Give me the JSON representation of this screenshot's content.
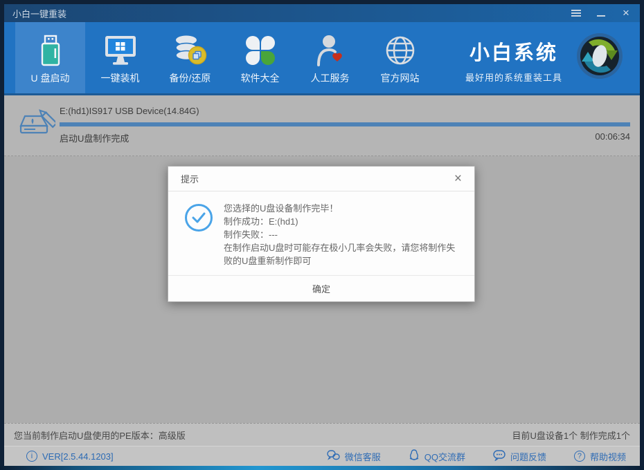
{
  "window": {
    "title": "小白一键重装"
  },
  "nav": {
    "items": [
      {
        "label": "U 盘启动",
        "selected": true
      },
      {
        "label": "一键装机",
        "selected": false
      },
      {
        "label": "备份/还原",
        "selected": false
      },
      {
        "label": "软件大全",
        "selected": false
      },
      {
        "label": "人工服务",
        "selected": false
      },
      {
        "label": "官方网站",
        "selected": false
      }
    ],
    "brand": {
      "name": "小白系统",
      "tagline": "最好用的系统重装工具"
    }
  },
  "progress": {
    "device": "E:(hd1)IS917 USB Device(14.84G)",
    "status": "启动U盘制作完成",
    "time": "00:06:34",
    "percent": 100
  },
  "dialog": {
    "title": "提示",
    "lines": [
      "您选择的U盘设备制作完毕！",
      "制作成功：E:(hd1)",
      "制作失败：---",
      "在制作启动U盘时可能存在极小几率会失败，请您将制作失败的U盘重新制作即可"
    ],
    "ok_label": "确定"
  },
  "status_bar": {
    "left": "您当前制作启动U盘使用的PE版本：高级版",
    "right": "目前U盘设备1个 制作完成1个"
  },
  "footer": {
    "version": "VER[2.5.44.1203]",
    "links": [
      {
        "label": "微信客服"
      },
      {
        "label": "QQ交流群"
      },
      {
        "label": "问题反馈"
      },
      {
        "label": "帮助视频"
      }
    ]
  },
  "icons": {
    "close_glyph": "×",
    "help_glyph": "?",
    "info_glyph": "i"
  },
  "colors": {
    "nav_blue": "#2173c2",
    "selected_tab_blue": "#3d84cb",
    "progress_bar_blue": "#4d82b6",
    "dialog_check_blue": "#4aa4e8",
    "link_blue": "#2f6cb5",
    "dim_gray": "#adadad"
  }
}
